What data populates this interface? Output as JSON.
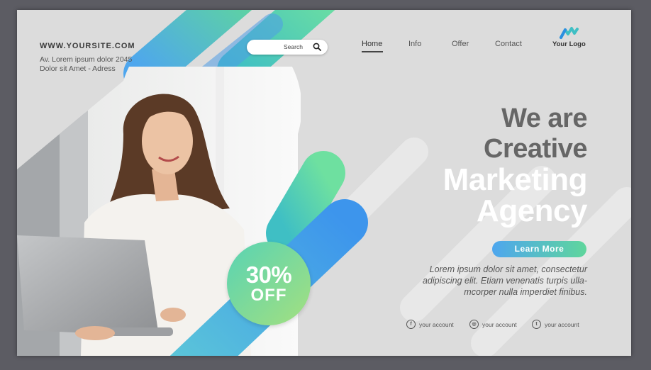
{
  "header": {
    "site_url": "WWW.YOURSITE.COM",
    "address_line1": "Av. Lorem ipsum dolor 2045",
    "address_line2": "Dolor sit Amet - Adress",
    "search_placeholder": "Search",
    "nav": [
      "Home",
      "Info",
      "Offer",
      "Contact"
    ],
    "active_nav": "Home",
    "logo_text": "Your Logo"
  },
  "hero": {
    "headline": [
      "We are",
      "Creative",
      "Marketing",
      "Agency"
    ],
    "cta_label": "Learn More",
    "description": [
      "Lorem ipsum dolor sit amet, consectetur",
      "adipiscing elit. Etiam venenatis turpis ulla-",
      "mcorper nulla imperdiet finibus."
    ],
    "badge_percent": "30%",
    "badge_text": "OFF"
  },
  "social": [
    {
      "icon": "facebook-icon",
      "label": "your account"
    },
    {
      "icon": "instagram-icon",
      "label": "your account"
    },
    {
      "icon": "twitter-icon",
      "label": "your account"
    }
  ],
  "colors": {
    "background": "#dcdcdc",
    "frame": "#5c5c63",
    "accent_blue": "#4ea6ee",
    "accent_green": "#5fd69c",
    "teal": "#45c9b6",
    "headline_gray": "#666666"
  }
}
